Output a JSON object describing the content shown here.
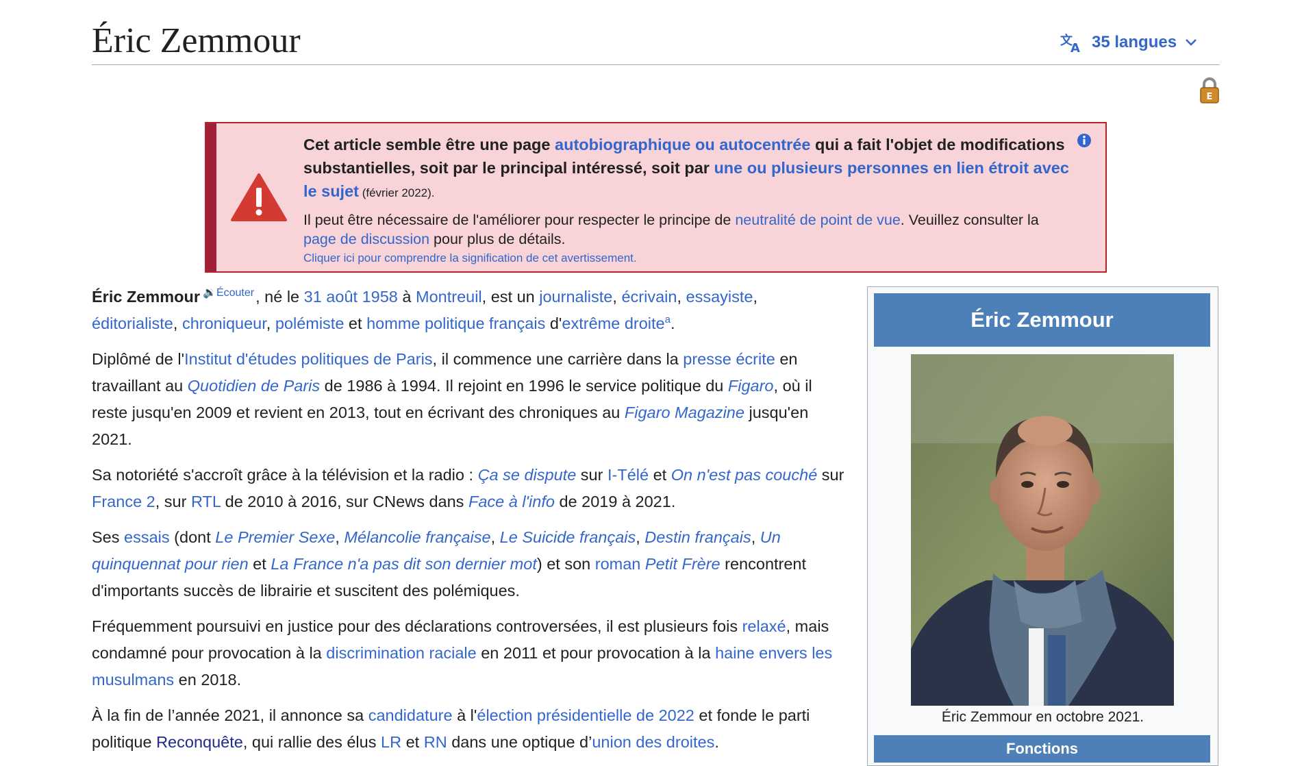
{
  "page": {
    "title": "Éric Zemmour",
    "languages_label": "35 langues"
  },
  "banner": {
    "line1_pre": "Cet article semble être une page ",
    "line1_link": "autobiographique ou autocentrée",
    "line1_mid": " qui a fait l'objet de modifications substantielles, soit par le principal intéressé, soit par ",
    "line1_link2": "une ou plusieurs personnes en lien étroit avec le sujet",
    "date": " (février 2022).",
    "body_pre": "Il peut être nécessaire de l'améliorer pour respecter le principe de ",
    "body_link1": "neutralité de point de vue",
    "body_mid": ". Veuillez consulter la ",
    "body_link2": "page de discussion",
    "body_post": " pour plus de détails.",
    "note": "Cliquer ici pour comprendre la signification de cet avertissement."
  },
  "article": {
    "p1": {
      "name": "Éric Zemmour",
      "listen": "Écouter",
      "t1": ", né le ",
      "date": "31 août 1958",
      "t2": " à ",
      "place": "Montreuil",
      "t3": ", est un ",
      "l1": "journaliste",
      "l2": "écrivain",
      "l3": "essayiste",
      "l4": "éditorialiste",
      "l5": "chroniqueur",
      "l6": "polémiste",
      "t4": " et ",
      "l7": "homme politique français",
      "t5": " d'",
      "l8": "extrême droite",
      "note": "a",
      "t6": "."
    },
    "p2": {
      "t1": "Diplômé de l'",
      "l1": "Institut d'études politiques de Paris",
      "t2": ", il commence une carrière dans la ",
      "l2": "presse écrite",
      "t3": " en travaillant au ",
      "l3": "Quotidien de Paris",
      "t4": " de 1986 à 1994. Il rejoint en 1996 le service politique du ",
      "l4": "Figaro",
      "t5": ", où il reste jusqu'en 2009 et revient en 2013, tout en écrivant des chroniques au ",
      "l5": "Figaro Magazine",
      "t6": " jusqu'en 2021."
    },
    "p3": {
      "t1": "Sa notoriété s'accroît grâce à la télévision et la radio : ",
      "l1": "Ça se dispute",
      "t2": " sur ",
      "l2": "I-Télé",
      "t3": " et ",
      "l3": "On n'est pas couché",
      "t4": " sur ",
      "l4": "France 2",
      "t5": ", sur ",
      "l5": "RTL",
      "t6": " de 2010 à 2016, sur CNews dans ",
      "l6": "Face à l'info",
      "t7": " de 2019 à 2021."
    },
    "p4": {
      "t1": "Ses ",
      "l1": "essais",
      "t2": " (dont ",
      "l2": "Le Premier Sexe",
      "l3": "Mélancolie française",
      "l4": "Le Suicide français",
      "l5": "Destin français",
      "l6": "Un quinquennat pour rien",
      "t3": " et ",
      "l7": "La France n'a pas dit son dernier mot",
      "t4": ") et son ",
      "l8": "roman",
      "l9": "Petit Frère",
      "t5": " rencontrent d'importants succès de librairie et suscitent des polémiques."
    },
    "p5": {
      "t1": "Fréquemment poursuivi en justice pour des déclarations controversées, il est plusieurs fois ",
      "l1": "relaxé",
      "t2": ", mais condamné pour provocation à la ",
      "l2": "discrimination raciale",
      "t3": " en 2011 et pour provocation à la ",
      "l3": "haine envers les musulmans",
      "t4": " en 2018."
    },
    "p6": {
      "t1": "À la fin de l’année 2021, il annonce sa ",
      "l1": "candidature",
      "t2": " à l'",
      "l2": "élection présidentielle de 2022",
      "t3": " et fonde le parti politique ",
      "l3": "Reconquête",
      "t4": ", qui rallie des élus ",
      "l4": "LR",
      "t5": " et ",
      "l5": "RN",
      "t6": " dans une optique d’",
      "l6": "union des droites",
      "t7": "."
    }
  },
  "infobox": {
    "title": "Éric Zemmour",
    "caption": "Éric Zemmour en octobre 2021.",
    "section": "Fonctions"
  },
  "colors": {
    "link": "#3366cc",
    "banner_bg": "#f8d3d7",
    "banner_border": "#b32424",
    "infobox_header": "#4d80b8"
  },
  "icons": [
    "translate-icon",
    "chevron-down-icon",
    "lock-icon",
    "warning-icon",
    "info-icon",
    "speaker-icon"
  ]
}
